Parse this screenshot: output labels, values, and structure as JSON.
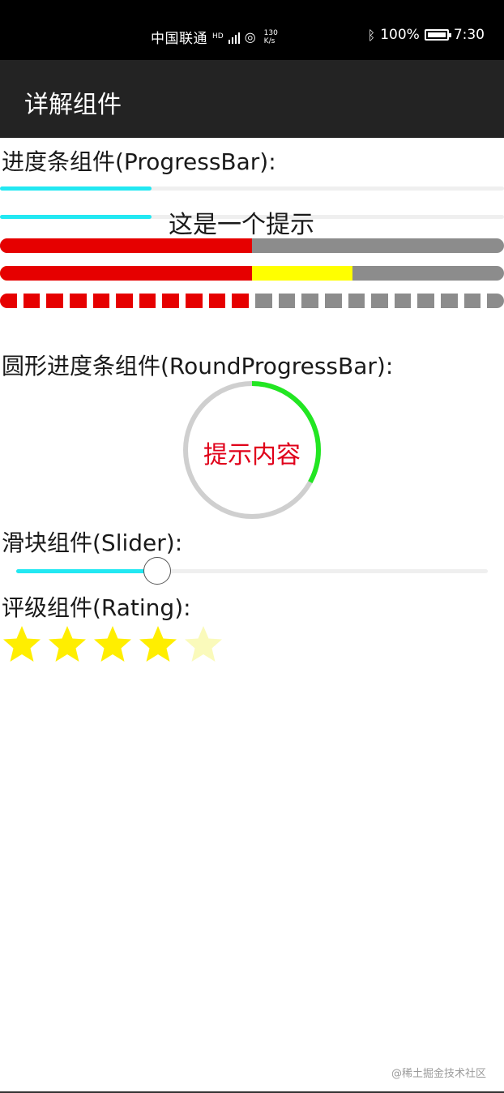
{
  "status_bar": {
    "carrier": "中国联通",
    "network_small": "HD",
    "speed_value": "130",
    "speed_unit": "K/s",
    "battery": "100%",
    "time": "7:30"
  },
  "app_bar": {
    "title": "详解组件"
  },
  "progress_section": {
    "label": "进度条组件(ProgressBar):",
    "thin_bar_1": {
      "progress": 0.3
    },
    "thin_bar_2": {
      "progress": 0.3,
      "hint": "这是一个提示"
    },
    "thick_bar_1": {
      "progress": 0.5
    },
    "thick_bar_2": {
      "progress": 0.5,
      "secondary_progress": 0.7
    },
    "segmented_bar": {
      "progress": 0.5,
      "segments": 22
    }
  },
  "round_section": {
    "label": "圆形进度条组件(RoundProgressBar):",
    "progress": 0.33,
    "text": "提示内容"
  },
  "slider_section": {
    "label": "滑块组件(Slider):",
    "value": 0.3
  },
  "rating_section": {
    "label": "评级组件(Rating):",
    "value": 4,
    "max": 5
  },
  "watermark": "@稀土掘金技术社区",
  "colors": {
    "accent_cyan": "#22e8f2",
    "red": "#e60000",
    "yellow": "#ffff00",
    "gray": "#8c8c8c",
    "green": "#22e622",
    "star_on": "#ffee00",
    "star_off": "#fafabb",
    "round_text": "#e0001a"
  },
  "icons": [
    "signal-icon",
    "wifi-icon",
    "bluetooth-icon",
    "battery-icon"
  ]
}
